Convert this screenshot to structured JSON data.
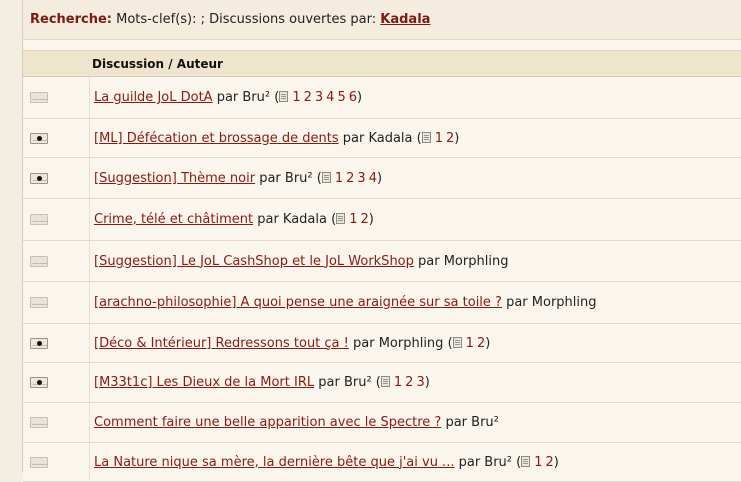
{
  "search": {
    "label": "Recherche:",
    "keywords_text": " Mots-clef(s): ; Discussions ouvertes par: ",
    "author": "Kadala"
  },
  "table": {
    "header": "Discussion / Auteur",
    "par_label": "par",
    "rows": [
      {
        "status": "read",
        "title": "La guilde JoL DotA",
        "author": "Bru²",
        "pages": [
          "1",
          "2",
          "3",
          "4",
          "5",
          "6"
        ]
      },
      {
        "status": "new",
        "title": "[ML] Défécation et brossage de dents",
        "author": "Kadala",
        "pages": [
          "1",
          "2"
        ]
      },
      {
        "status": "new",
        "title": "[Suggestion] Thème noir",
        "author": "Bru²",
        "pages": [
          "1",
          "2",
          "3",
          "4"
        ]
      },
      {
        "status": "read",
        "title": "Crime, télé et châtiment",
        "author": "Kadala",
        "pages": [
          "1",
          "2"
        ]
      },
      {
        "status": "read",
        "title": "[Suggestion] Le JoL CashShop et le JoL WorkShop",
        "author": "Morphling",
        "pages": []
      },
      {
        "status": "read",
        "title": "[arachno-philosophie] A quoi pense une araignée sur sa toile ?",
        "author": "Morphling",
        "pages": []
      },
      {
        "status": "new",
        "title": "[Déco & Intérieur] Redressons tout ça !",
        "author": "Morphling",
        "pages": [
          "1",
          "2"
        ]
      },
      {
        "status": "new",
        "title": "[M33t1c] Les Dieux de la Mort IRL",
        "author": "Bru²",
        "pages": [
          "1",
          "2",
          "3"
        ]
      },
      {
        "status": "read",
        "title": "Comment faire une belle apparition avec le Spectre ?",
        "author": "Bru²",
        "pages": []
      },
      {
        "status": "read",
        "title": "La Nature nique sa mère, la dernière bête que j'ai vu ...",
        "author": "Bru²",
        "pages": [
          "1",
          "2"
        ]
      }
    ]
  }
}
